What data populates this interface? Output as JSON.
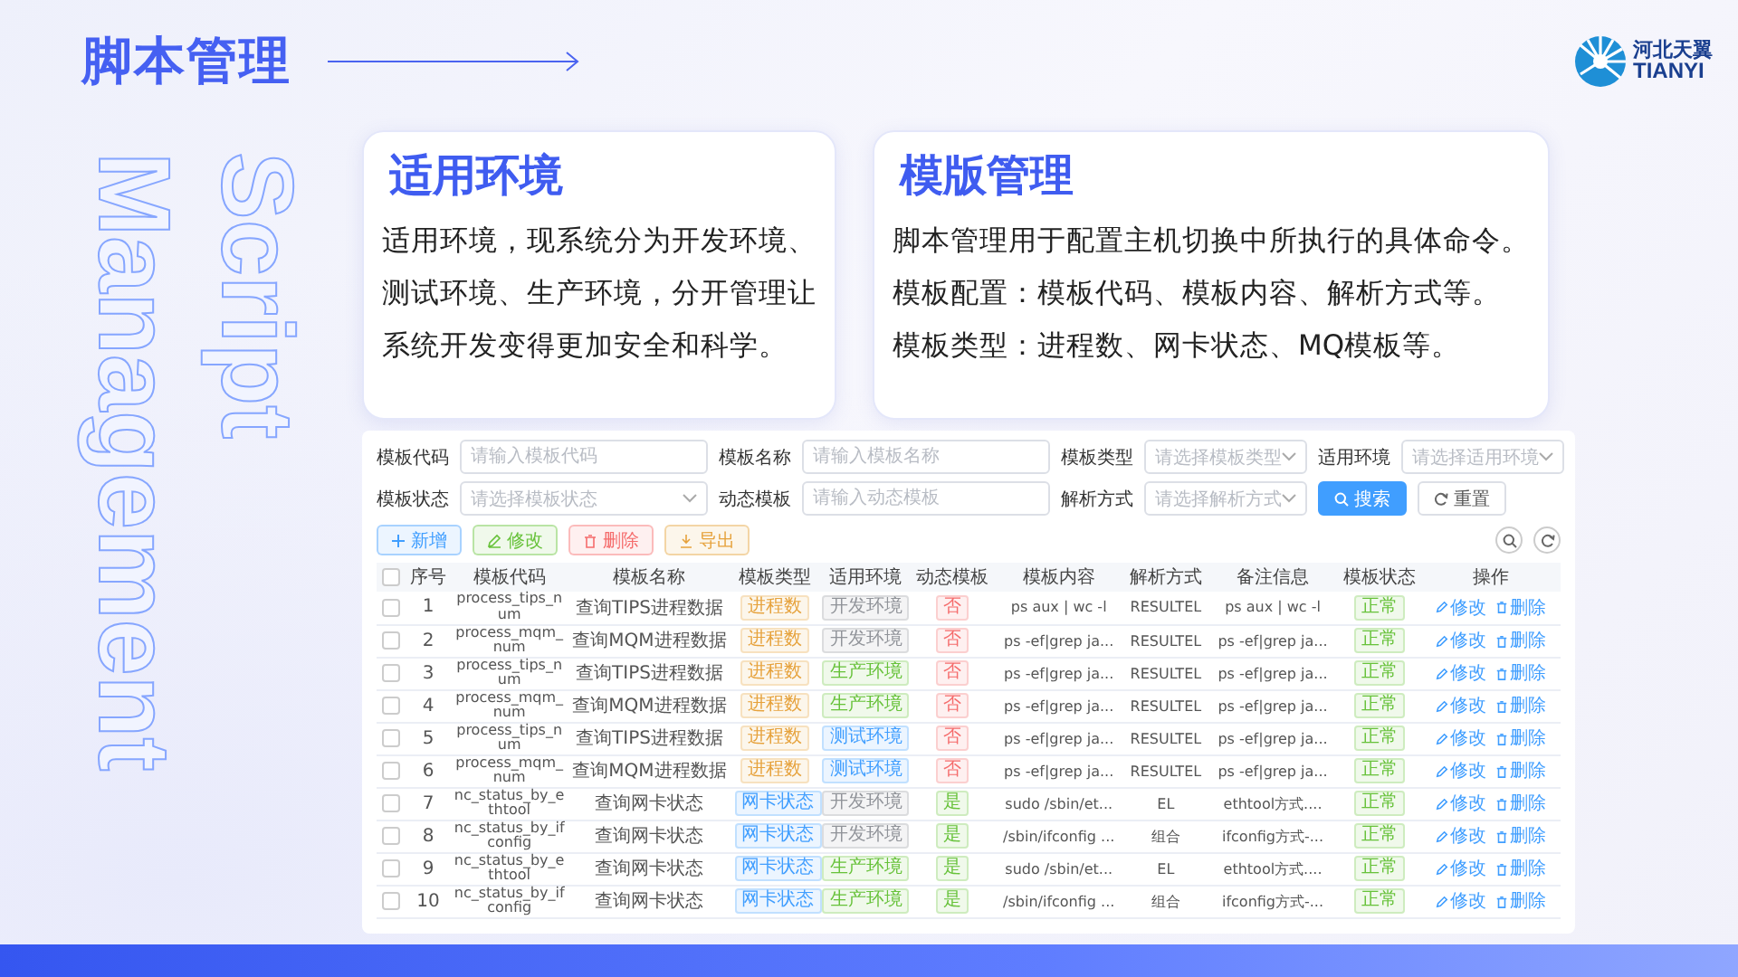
{
  "header": {
    "title": "脚本管理",
    "logo": {
      "name_cn": "河北天翼",
      "name_en": "TIANYI"
    }
  },
  "side_text": [
    "Script",
    "Management"
  ],
  "cards": [
    {
      "title": "适用环境",
      "paragraphs": [
        "适用环境，现系统分为开发环境、测试环境、生产环境，分开管理让系统开发变得更加安全和科学。"
      ]
    },
    {
      "title": "模版管理",
      "paragraphs": [
        "脚本管理用于配置主机切换中所执行的具体命令。",
        "模板配置：模板代码、模板内容、解析方式等。",
        "模板类型：进程数、网卡状态、MQ模板等。"
      ]
    }
  ],
  "filters": [
    {
      "label": "模板代码",
      "kind": "input",
      "placeholder": "请输入模板代码"
    },
    {
      "label": "模板名称",
      "kind": "input",
      "placeholder": "请输入模板名称"
    },
    {
      "label": "模板类型",
      "kind": "select",
      "placeholder": "请选择模板类型"
    },
    {
      "label": "适用环境",
      "kind": "select",
      "placeholder": "请选择适用环境"
    },
    {
      "label": "模板状态",
      "kind": "select",
      "placeholder": "请选择模板状态"
    },
    {
      "label": "动态模板",
      "kind": "input",
      "placeholder": "请输入动态模板"
    },
    {
      "label": "解析方式",
      "kind": "select",
      "placeholder": "请选择解析方式"
    }
  ],
  "filter_buttons": [
    {
      "label": "搜索",
      "kind": "primary"
    },
    {
      "label": "重置",
      "kind": "plain"
    }
  ],
  "toolbar": [
    {
      "label": "新增",
      "kind": "add"
    },
    {
      "label": "修改",
      "kind": "edit"
    },
    {
      "label": "删除",
      "kind": "delete"
    },
    {
      "label": "导出",
      "kind": "export"
    }
  ],
  "table": {
    "header_checked": false,
    "columns": [
      "序号",
      "模板代码",
      "模板名称",
      "模板类型",
      "适用环境",
      "动态模板",
      "模板内容",
      "解析方式",
      "备注信息",
      "模板状态",
      "操作"
    ],
    "rows": [
      {
        "checked": false,
        "index": "1",
        "code": "process_tips_num",
        "name": "查询TIPS进程数据",
        "type": {
          "text": "进程数",
          "color": "#e6a23c"
        },
        "env": {
          "text": "开发环境",
          "color": "#909399"
        },
        "dynamic": {
          "text": "否",
          "color": "#f56c6c"
        },
        "content": "ps aux | wc -l",
        "parse": "RESULTEL",
        "note": "ps aux | wc -l",
        "status": {
          "text": "正常",
          "color": "#67c23a"
        },
        "actions": [
          "修改",
          "删除"
        ]
      },
      {
        "checked": false,
        "index": "2",
        "code": "process_mqm_num",
        "name": "查询MQM进程数据",
        "type": {
          "text": "进程数",
          "color": "#e6a23c"
        },
        "env": {
          "text": "开发环境",
          "color": "#909399"
        },
        "dynamic": {
          "text": "否",
          "color": "#f56c6c"
        },
        "content": "ps -ef|grep ja...",
        "parse": "RESULTEL",
        "note": "ps -ef|grep ja...",
        "status": {
          "text": "正常",
          "color": "#67c23a"
        },
        "actions": [
          "修改",
          "删除"
        ]
      },
      {
        "checked": false,
        "index": "3",
        "code": "process_tips_num",
        "name": "查询TIPS进程数据",
        "type": {
          "text": "进程数",
          "color": "#e6a23c"
        },
        "env": {
          "text": "生产环境",
          "color": "#67c23a"
        },
        "dynamic": {
          "text": "否",
          "color": "#f56c6c"
        },
        "content": "ps -ef|grep ja...",
        "parse": "RESULTEL",
        "note": "ps -ef|grep ja...",
        "status": {
          "text": "正常",
          "color": "#67c23a"
        },
        "actions": [
          "修改",
          "删除"
        ]
      },
      {
        "checked": false,
        "index": "4",
        "code": "process_mqm_num",
        "name": "查询MQM进程数据",
        "type": {
          "text": "进程数",
          "color": "#e6a23c"
        },
        "env": {
          "text": "生产环境",
          "color": "#67c23a"
        },
        "dynamic": {
          "text": "否",
          "color": "#f56c6c"
        },
        "content": "ps -ef|grep ja...",
        "parse": "RESULTEL",
        "note": "ps -ef|grep ja...",
        "status": {
          "text": "正常",
          "color": "#67c23a"
        },
        "actions": [
          "修改",
          "删除"
        ]
      },
      {
        "checked": false,
        "index": "5",
        "code": "process_tips_num",
        "name": "查询TIPS进程数据",
        "type": {
          "text": "进程数",
          "color": "#e6a23c"
        },
        "env": {
          "text": "测试环境",
          "color": "#409eff"
        },
        "dynamic": {
          "text": "否",
          "color": "#f56c6c"
        },
        "content": "ps -ef|grep ja...",
        "parse": "RESULTEL",
        "note": "ps -ef|grep ja...",
        "status": {
          "text": "正常",
          "color": "#67c23a"
        },
        "actions": [
          "修改",
          "删除"
        ]
      },
      {
        "checked": false,
        "index": "6",
        "code": "process_mqm_num",
        "name": "查询MQM进程数据",
        "type": {
          "text": "进程数",
          "color": "#e6a23c"
        },
        "env": {
          "text": "测试环境",
          "color": "#409eff"
        },
        "dynamic": {
          "text": "否",
          "color": "#f56c6c"
        },
        "content": "ps -ef|grep ja...",
        "parse": "RESULTEL",
        "note": "ps -ef|grep ja...",
        "status": {
          "text": "正常",
          "color": "#67c23a"
        },
        "actions": [
          "修改",
          "删除"
        ]
      },
      {
        "checked": false,
        "index": "7",
        "code": "nc_status_by_ethtool",
        "name": "查询网卡状态",
        "type": {
          "text": "网卡状态",
          "color": "#409eff"
        },
        "env": {
          "text": "开发环境",
          "color": "#909399"
        },
        "dynamic": {
          "text": "是",
          "color": "#67c23a"
        },
        "content": "sudo /sbin/et...",
        "parse": "EL",
        "note": "ethtool方式....",
        "status": {
          "text": "正常",
          "color": "#67c23a"
        },
        "actions": [
          "修改",
          "删除"
        ]
      },
      {
        "checked": false,
        "index": "8",
        "code": "nc_status_by_ifconfig",
        "name": "查询网卡状态",
        "type": {
          "text": "网卡状态",
          "color": "#409eff"
        },
        "env": {
          "text": "开发环境",
          "color": "#909399"
        },
        "dynamic": {
          "text": "是",
          "color": "#67c23a"
        },
        "content": "/sbin/ifconfig ...",
        "parse": "组合",
        "note": "ifconfig方式-...",
        "status": {
          "text": "正常",
          "color": "#67c23a"
        },
        "actions": [
          "修改",
          "删除"
        ]
      },
      {
        "checked": false,
        "index": "9",
        "code": "nc_status_by_ethtool",
        "name": "查询网卡状态",
        "type": {
          "text": "网卡状态",
          "color": "#409eff"
        },
        "env": {
          "text": "生产环境",
          "color": "#67c23a"
        },
        "dynamic": {
          "text": "是",
          "color": "#67c23a"
        },
        "content": "sudo /sbin/et...",
        "parse": "EL",
        "note": "ethtool方式....",
        "status": {
          "text": "正常",
          "color": "#67c23a"
        },
        "actions": [
          "修改",
          "删除"
        ]
      },
      {
        "checked": false,
        "index": "10",
        "code": "nc_status_by_ifconfig",
        "name": "查询网卡状态",
        "type": {
          "text": "网卡状态",
          "color": "#409eff"
        },
        "env": {
          "text": "生产环境",
          "color": "#67c23a"
        },
        "dynamic": {
          "text": "是",
          "color": "#67c23a"
        },
        "content": "/sbin/ifconfig ...",
        "parse": "组合",
        "note": "ifconfig方式-...",
        "status": {
          "text": "正常",
          "color": "#67c23a"
        },
        "actions": [
          "修改",
          "删除"
        ]
      }
    ]
  }
}
